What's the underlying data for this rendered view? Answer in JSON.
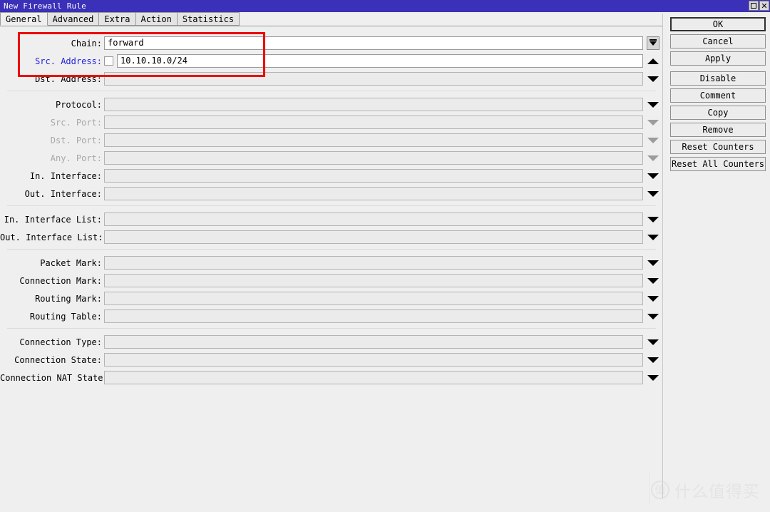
{
  "window": {
    "title": "New Firewall Rule",
    "title_bar_color": "#3b30b8",
    "controls": [
      {
        "name": "maximize",
        "glyph": "□"
      },
      {
        "name": "close",
        "glyph": "✕"
      }
    ]
  },
  "tabs": [
    {
      "label": "General",
      "active": true
    },
    {
      "label": "Advanced",
      "active": false
    },
    {
      "label": "Extra",
      "active": false
    },
    {
      "label": "Action",
      "active": false
    },
    {
      "label": "Statistics",
      "active": false
    }
  ],
  "form": {
    "groups": [
      {
        "fields": [
          {
            "label": "Chain:",
            "value": "forward",
            "placeholder": "",
            "state": "filled",
            "checkbox": false,
            "control": "dropdown-button",
            "width": "long"
          },
          {
            "label": "Src. Address:",
            "value": "10.10.10.0/24",
            "placeholder": "",
            "state": "focused",
            "checkbox": true,
            "checked": false,
            "control": "arrow-up",
            "width": "long"
          },
          {
            "label": "Dst. Address:",
            "value": "",
            "placeholder": "",
            "state": "empty",
            "checkbox": false,
            "control": "arrow-down",
            "width": "long"
          }
        ]
      },
      {
        "fields": [
          {
            "label": "Protocol:",
            "value": "",
            "placeholder": "",
            "state": "empty",
            "checkbox": false,
            "control": "arrow-down",
            "width": "long"
          },
          {
            "label": "Src. Port:",
            "value": "",
            "placeholder": "",
            "state": "disabled",
            "checkbox": false,
            "control": "arrow-down-dim",
            "width": "short"
          },
          {
            "label": "Dst. Port:",
            "value": "",
            "placeholder": "",
            "state": "disabled",
            "checkbox": false,
            "control": "arrow-down-dim",
            "width": "short"
          },
          {
            "label": "Any. Port:",
            "value": "",
            "placeholder": "",
            "state": "disabled",
            "checkbox": false,
            "control": "arrow-down-dim",
            "width": "short"
          },
          {
            "label": "In. Interface:",
            "value": "",
            "placeholder": "",
            "state": "empty",
            "checkbox": false,
            "control": "arrow-down",
            "width": "long"
          },
          {
            "label": "Out. Interface:",
            "value": "",
            "placeholder": "",
            "state": "empty",
            "checkbox": false,
            "control": "arrow-down",
            "width": "long"
          }
        ]
      },
      {
        "fields": [
          {
            "label": "In. Interface List:",
            "value": "",
            "placeholder": "",
            "state": "empty",
            "checkbox": false,
            "control": "arrow-down",
            "width": "long"
          },
          {
            "label": "Out. Interface List:",
            "value": "",
            "placeholder": "",
            "state": "empty",
            "checkbox": false,
            "control": "arrow-down",
            "width": "long"
          }
        ]
      },
      {
        "fields": [
          {
            "label": "Packet Mark:",
            "value": "",
            "placeholder": "",
            "state": "empty",
            "checkbox": false,
            "control": "arrow-down",
            "width": "long"
          },
          {
            "label": "Connection Mark:",
            "value": "",
            "placeholder": "",
            "state": "empty",
            "checkbox": false,
            "control": "arrow-down",
            "width": "long"
          },
          {
            "label": "Routing Mark:",
            "value": "",
            "placeholder": "",
            "state": "empty",
            "checkbox": false,
            "control": "arrow-down",
            "width": "long"
          },
          {
            "label": "Routing Table:",
            "value": "",
            "placeholder": "",
            "state": "empty",
            "checkbox": false,
            "control": "arrow-down",
            "width": "long"
          }
        ]
      },
      {
        "fields": [
          {
            "label": "Connection Type:",
            "value": "",
            "placeholder": "",
            "state": "empty",
            "checkbox": false,
            "control": "arrow-down",
            "width": "long"
          },
          {
            "label": "Connection State:",
            "value": "",
            "placeholder": "",
            "state": "empty",
            "checkbox": false,
            "control": "arrow-down",
            "width": "long"
          },
          {
            "label": "Connection NAT State:",
            "value": "",
            "placeholder": "",
            "state": "empty",
            "checkbox": false,
            "control": "arrow-down",
            "width": "long"
          }
        ]
      }
    ]
  },
  "buttons": [
    {
      "label": "OK",
      "primary": true,
      "gap": false
    },
    {
      "label": "Cancel",
      "primary": false,
      "gap": false
    },
    {
      "label": "Apply",
      "primary": false,
      "gap": false
    },
    {
      "label": "Disable",
      "primary": false,
      "gap": true
    },
    {
      "label": "Comment",
      "primary": false,
      "gap": false
    },
    {
      "label": "Copy",
      "primary": false,
      "gap": false
    },
    {
      "label": "Remove",
      "primary": false,
      "gap": false
    },
    {
      "label": "Reset Counters",
      "primary": false,
      "gap": false
    },
    {
      "label": "Reset All Counters",
      "primary": false,
      "gap": false
    }
  ],
  "annotation": {
    "color": "#ef0000",
    "highlights": [
      "Chain:",
      "Src. Address:"
    ]
  },
  "watermark": {
    "logo_char": "值",
    "text": "什么值得买"
  }
}
